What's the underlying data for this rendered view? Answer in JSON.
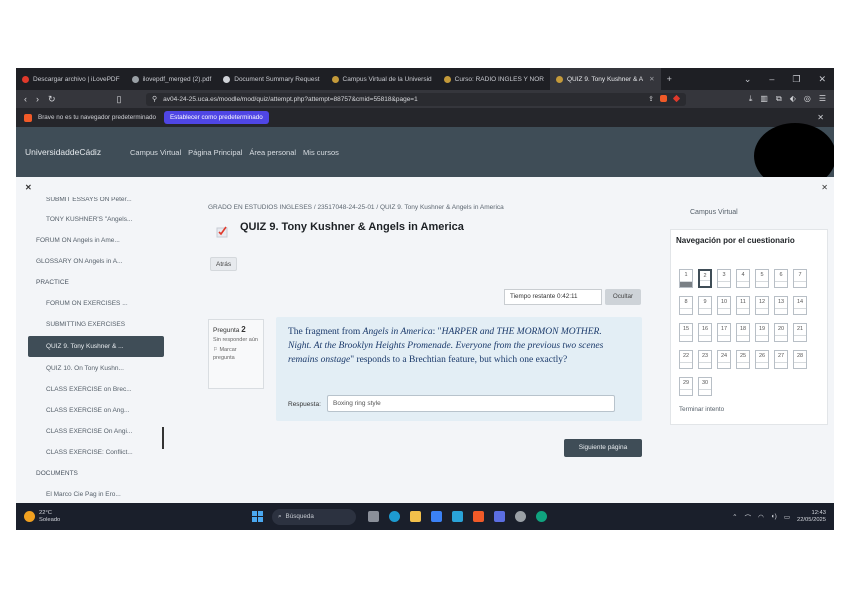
{
  "browser": {
    "tabs": [
      {
        "label": "Descargar archivo | iLovePDF",
        "color": "#e0392b"
      },
      {
        "label": "ilovepdf_merged (2).pdf",
        "color": "#9aa0a6"
      },
      {
        "label": "Document Summary Request",
        "color": "#d0d3d8"
      },
      {
        "label": "Campus Virtual de la Universid",
        "color": "#c49a3a"
      },
      {
        "label": "Curso: RADIO INGLES Y NOR",
        "color": "#c49a3a"
      },
      {
        "label": "QUIZ 9. Tony Kushner & A",
        "color": "#c49a3a"
      }
    ],
    "new_tab": "+",
    "url": "av04-24-25.uca.es/moodle/mod/quiz/attempt.php?attempt=88757&cmid=55818&page=1",
    "info_bar_text": "Brave no es tu navegador predeterminado",
    "set_default_label": "Establecer como predeterminado"
  },
  "moodle_nav": {
    "brand": "UniversidaddeCádiz",
    "links": [
      "Campus Virtual",
      "Página Principal",
      "Área personal",
      "Mis cursos"
    ]
  },
  "drawer": {
    "items": [
      {
        "label": "SUBMIT ESSAYS ON Peter...",
        "type": "indent"
      },
      {
        "label": "TONY KUSHNER'S \"Angels...",
        "type": "indent"
      },
      {
        "label": "FORUM ON Angels in Ame...",
        "type": "plain"
      },
      {
        "label": "GLOSSARY ON Angels in A...",
        "type": "plain"
      },
      {
        "label": "PRACTICE",
        "type": "section"
      },
      {
        "label": "FORUM ON EXERCISES ...",
        "type": "indent"
      },
      {
        "label": "SUBMITTING EXERCISES",
        "type": "indent"
      },
      {
        "label": "QUIZ 9. Tony Kushner & ...",
        "type": "active"
      },
      {
        "label": "QUIZ 10. On Tony Kushn...",
        "type": "indent"
      },
      {
        "label": "CLASS EXERCISE on Brec...",
        "type": "indent"
      },
      {
        "label": "CLASS EXERCISE on Ang...",
        "type": "indent"
      },
      {
        "label": "CLASS EXERCISE On Angi...",
        "type": "indent"
      },
      {
        "label": "CLASS EXERCISE: Conflict...",
        "type": "indent"
      },
      {
        "label": "DOCUMENTS",
        "type": "section"
      },
      {
        "label": "El Marco Cie Pag in Ero...",
        "type": "indent"
      }
    ]
  },
  "main": {
    "breadcrumb": "GRADO EN ESTUDIOS INGLESES / 23517048-24-25-01 / QUIZ 9. Tony Kushner & Angels in America",
    "page_title": "QUIZ 9. Tony Kushner & Angels in America",
    "back_label": "Atrás",
    "timer_text": "Tiempo restante 0:42:11",
    "hide_timer_label": "Ocultar",
    "question": {
      "number_label": "Pregunta",
      "number": "2",
      "status": "Sin responder aún",
      "flag_label": "Marcar pregunta",
      "text": "The fragment from Angels in America: \"HARPER and THE MORMON MOTHER. Night. At the Brooklyn Heights Promenade. Everyone from the previous two scenes remains onstage\" responds to a Brechtian feature, but which one exactly?",
      "answer_label": "Respuesta:",
      "answer_value": "Boxing ring style"
    },
    "next_label": "Siguiente página",
    "help_label": "?"
  },
  "quiz_nav": {
    "campus_label": "Campus Virtual",
    "title": "Navegación por el cuestionario",
    "cells": [
      "1",
      "2",
      "3",
      "4",
      "5",
      "6",
      "7",
      "8",
      "9",
      "10",
      "11",
      "12",
      "13",
      "14",
      "15",
      "16",
      "17",
      "18",
      "19",
      "20",
      "21",
      "22",
      "23",
      "24",
      "25",
      "26",
      "27",
      "28",
      "29",
      "30"
    ],
    "answered": [
      "1"
    ],
    "current": "2",
    "finish_label": "Terminar intento"
  },
  "taskbar": {
    "temp": "22°C",
    "condition": "Soleado",
    "search_placeholder": "Búsqueda",
    "time": "12:43",
    "date": "22/05/2025"
  }
}
